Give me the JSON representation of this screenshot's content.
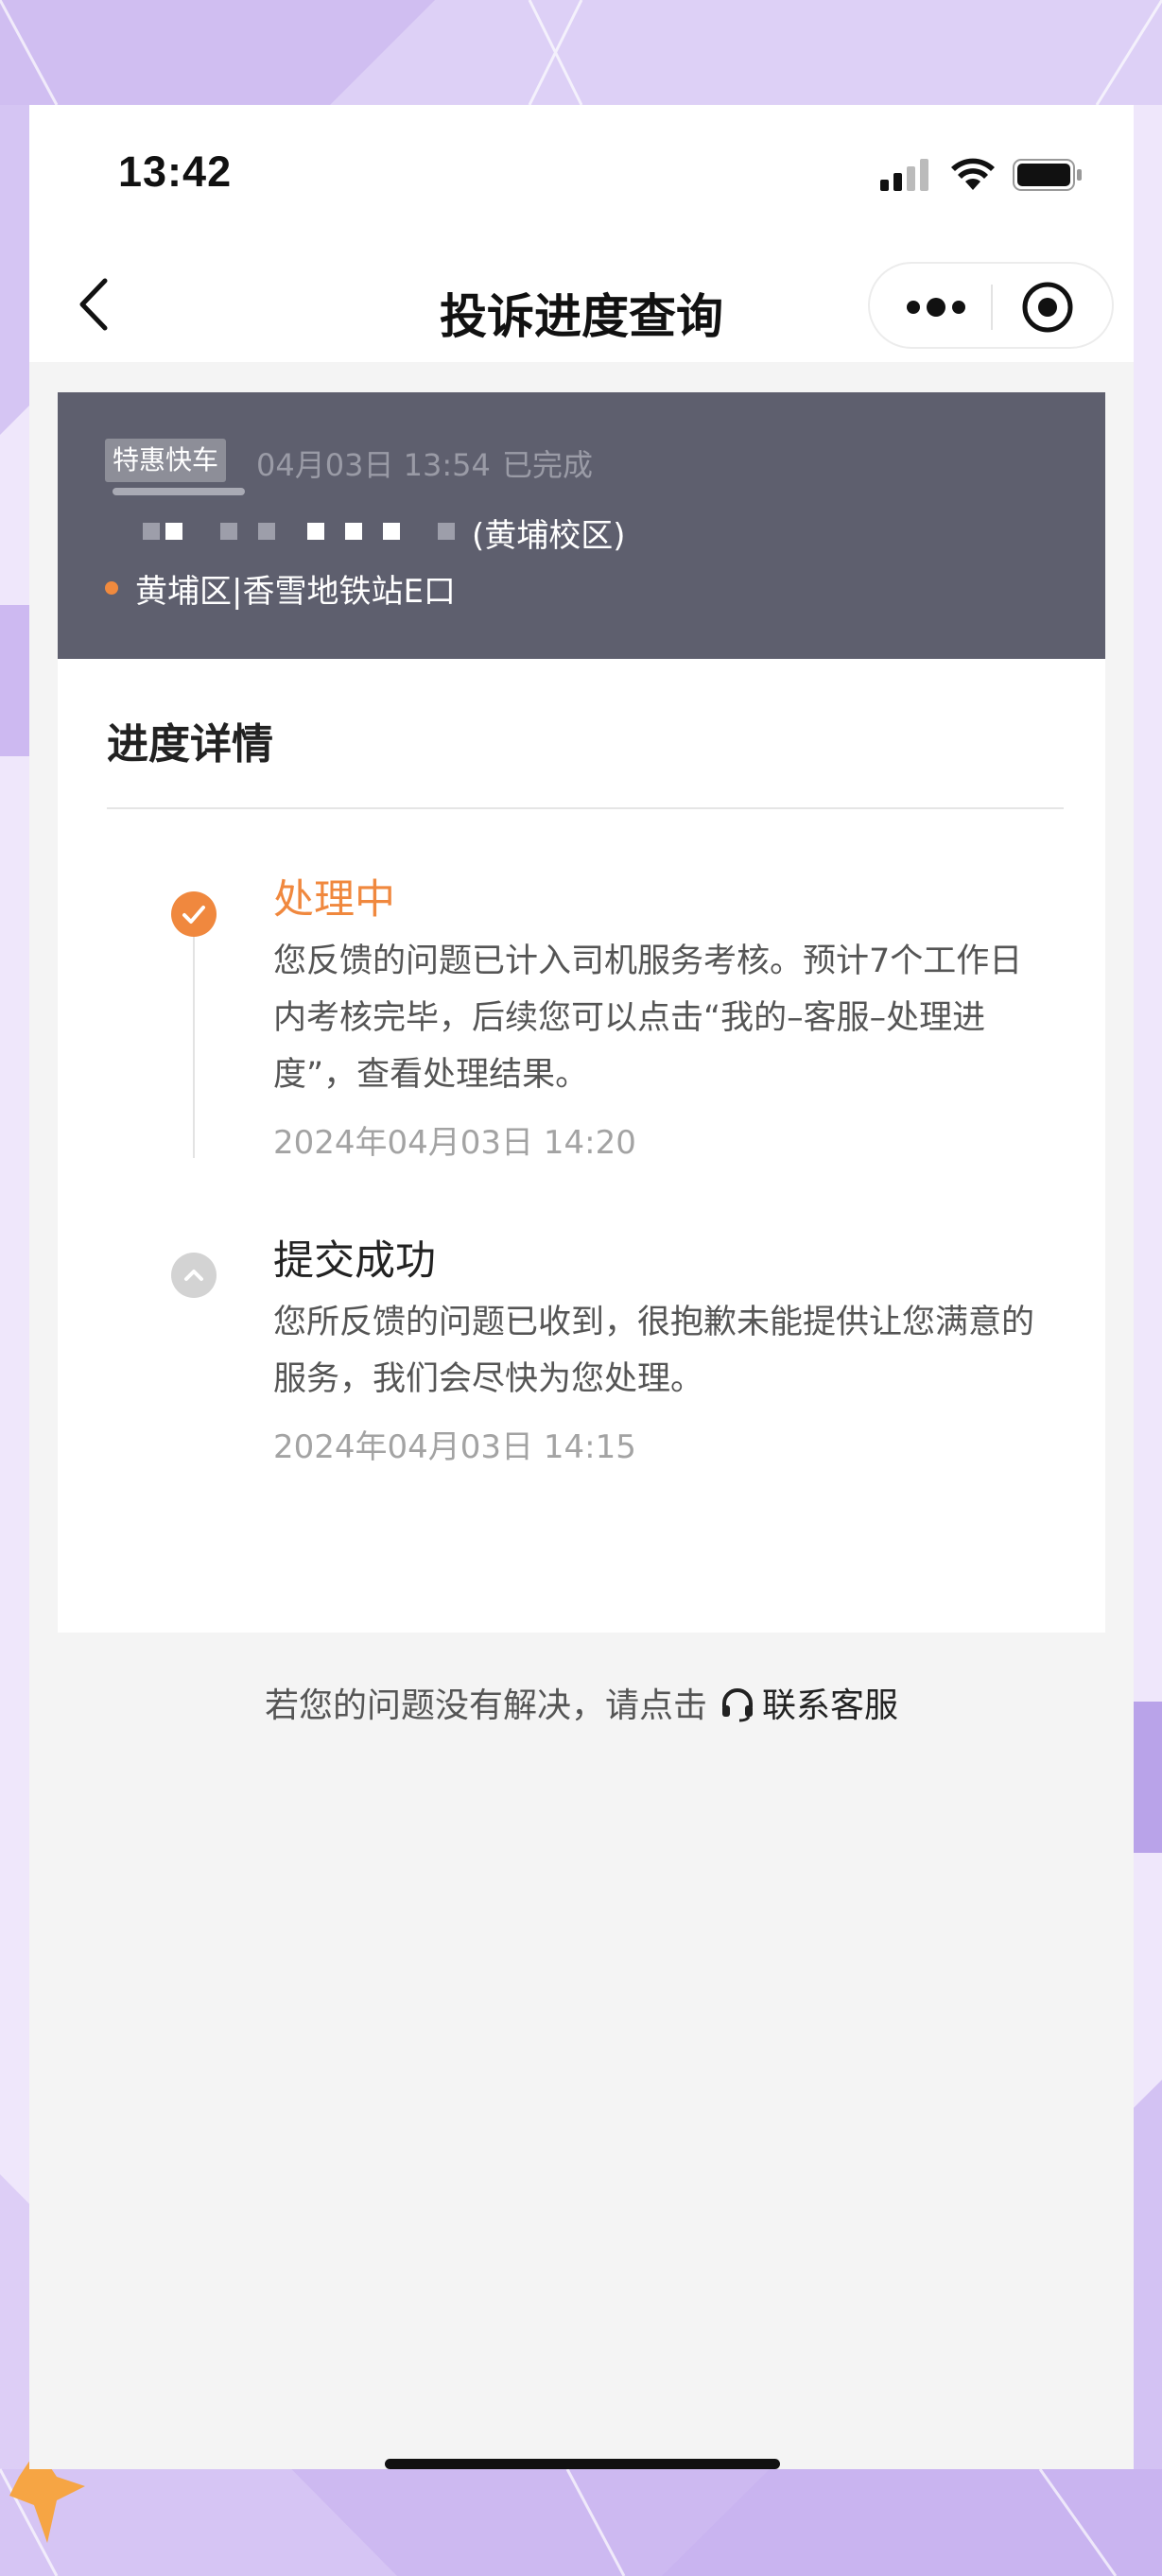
{
  "status_bar": {
    "time": "13:42"
  },
  "nav": {
    "title": "投诉进度查询"
  },
  "order": {
    "tag": "特惠快车",
    "time": "04月03日 13:54",
    "status": "已完成",
    "name_suffix": "(黄埔校区)",
    "location": "黄埔区|香雪地铁站E口"
  },
  "details": {
    "title": "进度详情",
    "steps": [
      {
        "title": "处理中",
        "description": "您反馈的问题已计入司机服务考核。预计7个工作日内考核完毕，后续您可以点击“我的–客服–处理进度”，查看处理结果。",
        "time": "2024年04月03日 14:20"
      },
      {
        "title": "提交成功",
        "description": "您所反馈的问题已收到，很抱歉未能提供让您满意的服务，我们会尽快为您处理。",
        "time": "2024年04月03日 14:15"
      }
    ]
  },
  "footer": {
    "prompt": "若您的问题没有解决，请点击",
    "contact_label": "联系客服"
  },
  "icons": {
    "back": "chevron-left-icon",
    "more": "more-dots-icon",
    "close": "target-circle-icon",
    "check": "check-icon",
    "collapse": "chevron-up-icon",
    "headset": "headset-icon"
  },
  "colors": {
    "accent": "#f0883e",
    "order_bg": "#5e5f6e"
  }
}
